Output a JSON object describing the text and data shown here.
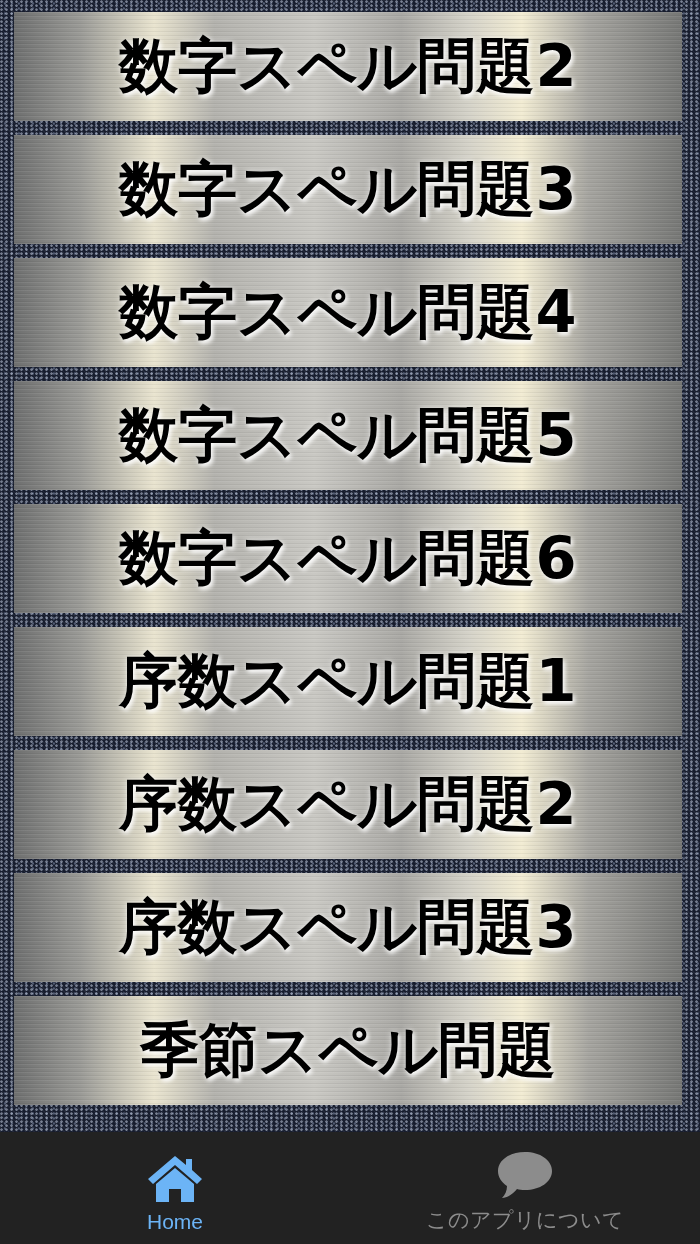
{
  "menu": {
    "items": [
      {
        "label": "数字スペル問題2"
      },
      {
        "label": "数字スペル問題3"
      },
      {
        "label": "数字スペル問題4"
      },
      {
        "label": "数字スペル問題5"
      },
      {
        "label": "数字スペル問題6"
      },
      {
        "label": "序数スペル問題1"
      },
      {
        "label": "序数スペル問題2"
      },
      {
        "label": "序数スペル問題3"
      },
      {
        "label": "季節スペル問題"
      }
    ]
  },
  "tab_bar": {
    "tabs": [
      {
        "kind": "home",
        "label": "Home",
        "selected": true
      },
      {
        "kind": "about",
        "label": "このアプリについて",
        "selected": false
      }
    ]
  }
}
